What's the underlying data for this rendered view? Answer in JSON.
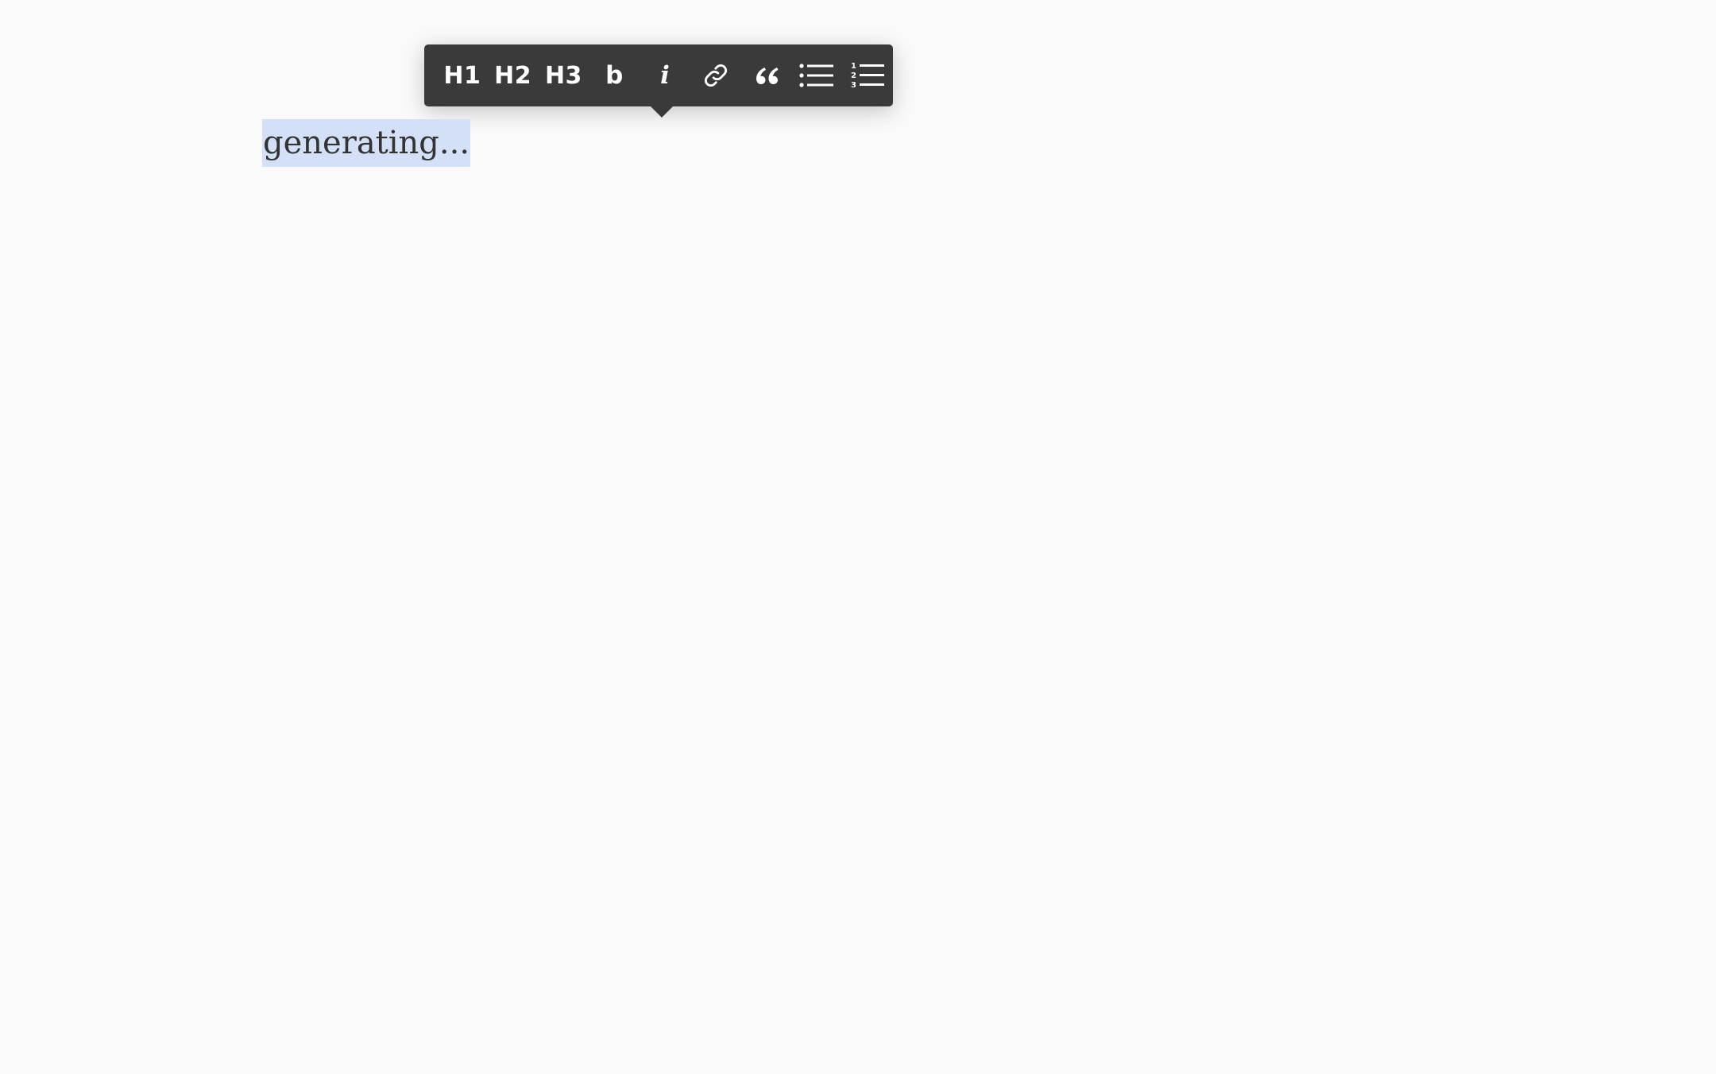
{
  "toolbar": {
    "h1_label": "H1",
    "h2_label": "H2",
    "h3_label": "H3",
    "bold_label": "b",
    "italic_label": "i",
    "link_icon": "link-icon",
    "quote_icon": "quote-icon",
    "unordered_list_icon": "bullet-list-icon",
    "ordered_list_icon": "numbered-list-icon",
    "ordered_list_numbers": [
      "1",
      "2",
      "3"
    ],
    "background_color": "#3a3a3a",
    "icon_color": "#ffffff"
  },
  "editor": {
    "content": "generating...",
    "selection_color": "#d3e0f7",
    "text_color": "#333333"
  },
  "page": {
    "background_color": "#fafafa"
  }
}
